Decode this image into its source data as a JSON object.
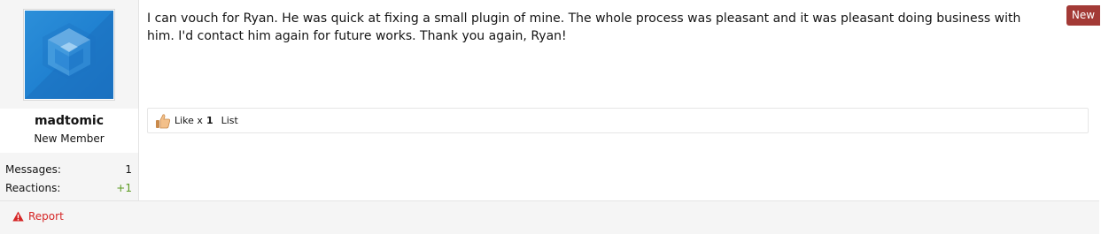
{
  "user": {
    "username": "madtomic",
    "title": "New Member",
    "avatar_icon": "cube-logo-icon",
    "stats": [
      {
        "label": "Messages:",
        "value": "1"
      },
      {
        "label": "Reactions:",
        "value": "+1"
      }
    ]
  },
  "post": {
    "badge": "New",
    "body": "I can vouch for Ryan. He was quick at fixing a small plugin of mine. The whole process was pleasant and it was pleasant doing business with him. I'd contact him again for future works. Thank you again, Ryan!",
    "reactions": {
      "icon": "thumbs-up-icon",
      "label": "Like x",
      "count": "1",
      "list_label": "List"
    }
  },
  "footer": {
    "report_label": "Report",
    "report_icon": "warning-icon"
  },
  "colors": {
    "badge_bg": "#a33a36",
    "report": "#d52525",
    "positive": "#5c9a21",
    "avatar_blue": "#1f80d0"
  }
}
